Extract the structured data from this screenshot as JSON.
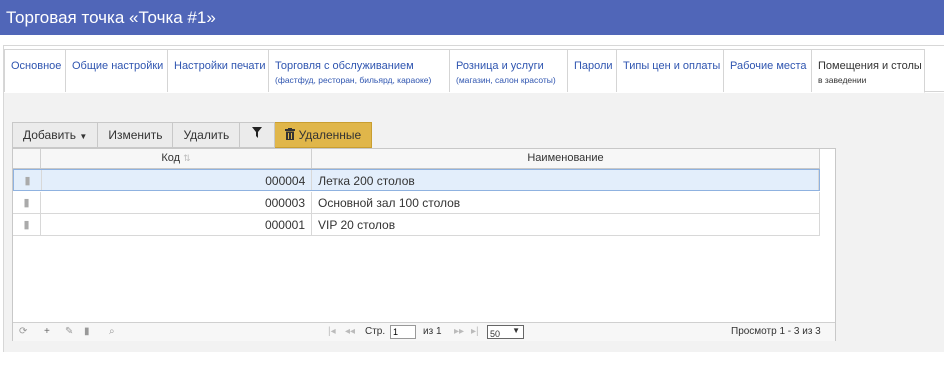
{
  "window": {
    "title": "Торговая точка «Точка #1»"
  },
  "tabs": [
    {
      "label": "Основное",
      "sub": ""
    },
    {
      "label": "Общие настройки",
      "sub": ""
    },
    {
      "label": "Настройки печати",
      "sub": ""
    },
    {
      "label": "Торговля с обслуживанием",
      "sub": "(фастфуд, ресторан, бильярд, караоке)"
    },
    {
      "label": "Розница и услуги",
      "sub": "(магазин, салон красоты)"
    },
    {
      "label": "Пароли",
      "sub": ""
    },
    {
      "label": "Типы цен и оплаты",
      "sub": ""
    },
    {
      "label": "Рабочие места",
      "sub": ""
    },
    {
      "label": "Помещения и столы",
      "sub": "в заведении"
    }
  ],
  "toolbar": {
    "add_label": "Добавить",
    "edit_label": "Изменить",
    "delete_label": "Удалить",
    "deleted_label": "Удаленные"
  },
  "grid": {
    "columns": {
      "code": "Код",
      "name": "Наименование"
    },
    "rows": [
      {
        "code": "000004",
        "name": "Летка 200 столов"
      },
      {
        "code": "000003",
        "name": "Основной зал 100 столов"
      },
      {
        "code": "000001",
        "name": "VIP 20 столов"
      }
    ]
  },
  "pager": {
    "page_label": "Стр.",
    "page_value": "1",
    "of_label": "из 1",
    "page_size": "50",
    "summary": "Просмотр 1 - 3 из 3"
  },
  "colors": {
    "titlebar": "#5066b8",
    "link": "#2f55b0",
    "deleted_button": "#e0b64a",
    "selected_row": "#e3eefb"
  }
}
